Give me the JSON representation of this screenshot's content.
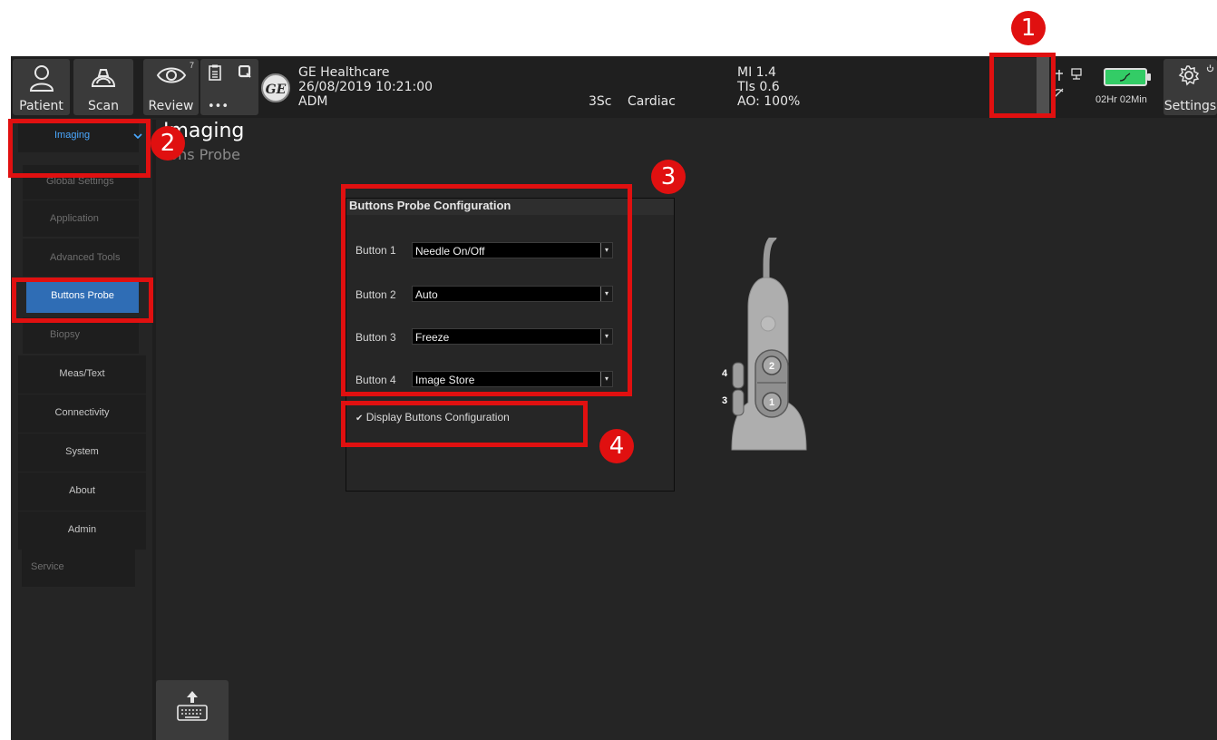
{
  "topbar": {
    "patient_label": "Patient",
    "scan_label": "Scan",
    "review_label": "Review",
    "review_count": "7",
    "more_label": "•••",
    "settings_label": "Settings",
    "company": "GE Healthcare",
    "datetime": "26/08/2019 10:21:00",
    "user": "ADM",
    "probe": "3Sc",
    "application": "Cardiac",
    "mi": "MI 1.4",
    "tis": "TIs 0.6",
    "ao": "AO: 100%",
    "battery_time": "02Hr  02Min",
    "battery_color": "#33cc66"
  },
  "sidebar": {
    "items": [
      {
        "label": "Imaging"
      },
      {
        "label": "Global Settings"
      },
      {
        "label": "Application"
      },
      {
        "label": "Advanced Tools"
      },
      {
        "label": "Buttons Probe"
      },
      {
        "label": "Biopsy"
      },
      {
        "label": "Meas/Text"
      },
      {
        "label": "Connectivity"
      },
      {
        "label": "System"
      },
      {
        "label": "About"
      },
      {
        "label": "Admin"
      },
      {
        "label": "Service"
      }
    ],
    "active_color": "#2f6db5",
    "accent_text_color": "#4aa8ff"
  },
  "main": {
    "title": "Imaging",
    "subtitle": "tons Probe",
    "panel_title": "Buttons Probe Configuration",
    "rows": [
      {
        "label": "Button 1",
        "value": "Needle On/Off"
      },
      {
        "label": "Button 2",
        "value": "Auto"
      },
      {
        "label": "Button 3",
        "value": "Freeze"
      },
      {
        "label": "Button 4",
        "value": "Image Store"
      }
    ],
    "checkbox_label": "Display Buttons Configuration",
    "checkbox_checked": true
  },
  "probe": {
    "side_labels": [
      "4",
      "3"
    ],
    "button_labels": [
      "2",
      "1"
    ]
  },
  "annotations": [
    "1",
    "2",
    "3",
    "4"
  ],
  "annotation_color": "#e01010"
}
